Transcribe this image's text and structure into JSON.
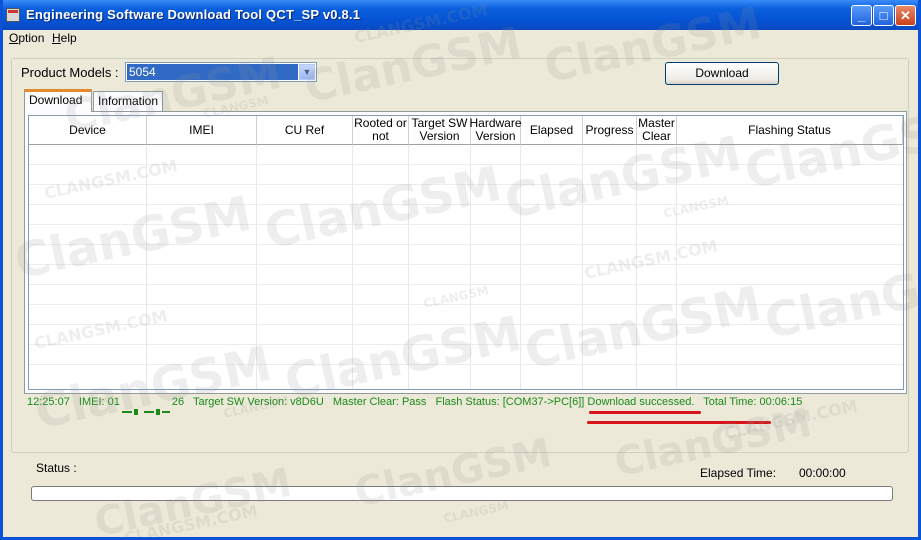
{
  "window": {
    "title": "Engineering Software Download Tool QCT_SP v0.8.1",
    "minimize_glyph": "_",
    "maximize_glyph": "□",
    "close_glyph": "✕"
  },
  "menu": {
    "option_accel": "O",
    "option_rest": "ption",
    "help_accel": "H",
    "help_rest": "elp"
  },
  "product": {
    "label": "Product Models :",
    "selected": "5054"
  },
  "download_button": "Download",
  "tabs": [
    {
      "label": "Download",
      "active": true
    },
    {
      "label": "Information",
      "active": false
    }
  ],
  "table": {
    "columns": [
      "Device",
      "IMEI",
      "CU Ref",
      "Rooted or not",
      "Target SW Version",
      "Hardware Version",
      "Elapsed",
      "Progress",
      "Master Clear",
      "Flashing Status"
    ],
    "rows": []
  },
  "log": {
    "time": "12:25:07",
    "imei_prefix": "IMEI: 01",
    "imei_suffix": "26",
    "target_sw": "Target SW Version: v8D6U",
    "master_clear": "Master Clear: Pass",
    "flash_status": "Flash Status: [COM37->PC[6]] Download successed.",
    "total_time": "Total Time: 00:06:15",
    "text_color": "#1a8a1a",
    "underline_color": "#d8141a"
  },
  "status": {
    "label": "Status :",
    "elapsed_label": "Elapsed Time:",
    "elapsed_value": "00:00:00",
    "progress": 0
  },
  "watermark": {
    "large": "ClanGSM",
    "small": "CLANGSM",
    "domain": "CLANGSM.COM"
  },
  "colors": {
    "titlebar": "#0553d2",
    "window_bg": "#ece9d8",
    "selection": "#316ac5",
    "active_tab_accent": "#e68b2c"
  }
}
